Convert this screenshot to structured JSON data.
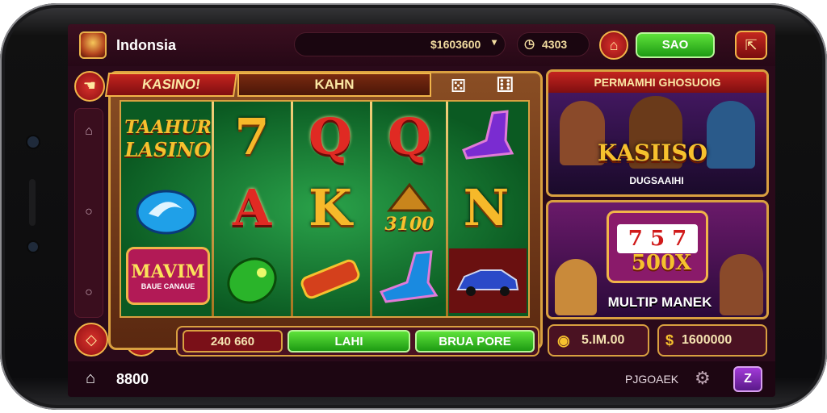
{
  "header": {
    "brand": "Indonsia",
    "balance_amount": "$1603600",
    "balance_secondary": "4303",
    "green_button": "SAO"
  },
  "machine": {
    "ribbon_left": "KASINO!",
    "ribbon_center": "KAHN",
    "title_logo_line1": "TAAHUR",
    "title_logo_line2": "LASINO",
    "badge_line1": "MAVIM",
    "badge_line2": "BAUE CANAUE",
    "symbols": {
      "seven": "7",
      "q1": "Q",
      "q2": "Q",
      "a": "A",
      "k": "K",
      "coin": "3100",
      "n": "N"
    }
  },
  "controls": {
    "bet_value": "240 660",
    "spin_label": "LAHI",
    "auto_label": "BRUA PORE"
  },
  "promo_top": {
    "banner": "PERMAMHI GHOSUOIG",
    "logo": "KASIISO",
    "sub": "DUGSAAIHI"
  },
  "promo_bottom": {
    "multiplier": "500X",
    "caption": "MULTIP MANEK"
  },
  "side_buttons": {
    "left_value": "5.IM.00",
    "right_value": "1600000"
  },
  "footer": {
    "score": "8800",
    "link": "PJGOAEK",
    "menu_icon_text": "Z"
  },
  "colors": {
    "accent_gold": "#d9a040",
    "brand_red": "#c4241f",
    "action_green": "#3fbf1f",
    "felt_green": "#1a7e36",
    "background": "#2a0a1a"
  },
  "icons": [
    "home-icon",
    "circle-icon",
    "diamond-icon",
    "refresh-icon",
    "settings-icon",
    "clock-icon",
    "chevron-down-icon",
    "coin-icon",
    "dollar-icon",
    "gear-icon",
    "menu-icon"
  ]
}
